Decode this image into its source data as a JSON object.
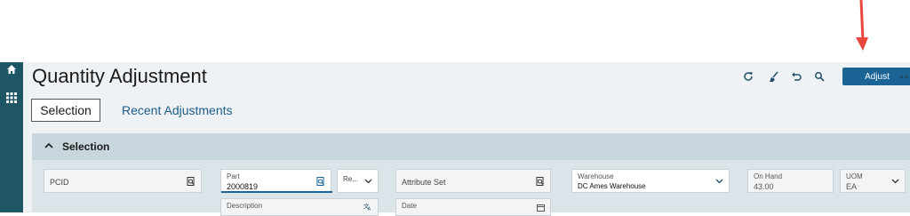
{
  "page": {
    "title": "Quantity Adjustment"
  },
  "toolbar": {
    "adjust_label": "Adjust",
    "more_label": "•••"
  },
  "tabs": [
    {
      "label": "Selection"
    },
    {
      "label": "Recent Adjustments"
    }
  ],
  "selection_panel": {
    "header": "Selection"
  },
  "fields": {
    "pcid": {
      "placeholder": "PCID"
    },
    "part": {
      "label": "Part",
      "value": "2000819"
    },
    "revision": {
      "placeholder": "Re..."
    },
    "attribute_set": {
      "placeholder": "Attribute Set"
    },
    "warehouse": {
      "label": "Warehouse",
      "value": "DC Ames Warehouse"
    },
    "on_hand": {
      "label": "On Hand",
      "value": "43.00"
    },
    "uom": {
      "label": "UOM",
      "value": "EA"
    },
    "description": {
      "label": "Description"
    },
    "date": {
      "label": "Date"
    }
  },
  "colors": {
    "sidebar": "#1f5665",
    "accent": "#1a6496",
    "annotation_arrow": "#e8473f"
  }
}
